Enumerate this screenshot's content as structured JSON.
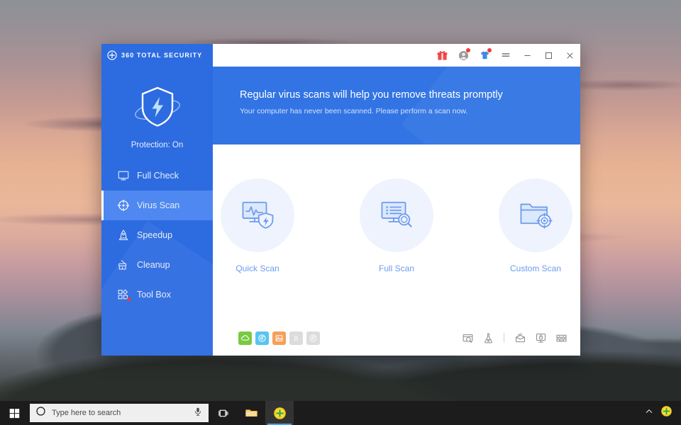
{
  "window": {
    "logo_text": "360 TOTAL SECURITY",
    "logo_icon": "circle-plus-icon",
    "title_icons": [
      {
        "name": "gift-icon",
        "badge": false
      },
      {
        "name": "user-account-icon",
        "badge": true
      },
      {
        "name": "skin-tshirt-icon",
        "badge": true
      },
      {
        "name": "hamburger-menu-icon",
        "badge": false
      }
    ],
    "controls": {
      "minimize": "minimize-icon",
      "maximize": "maximize-icon",
      "close": "close-icon"
    }
  },
  "sidebar": {
    "shield_icon": "shield-bolt-icon",
    "protection_status": "Protection: On",
    "items": [
      {
        "label": "Full Check",
        "icon": "monitor-icon",
        "active": false,
        "badge": false
      },
      {
        "label": "Virus Scan",
        "icon": "crosshair-target-icon",
        "active": true,
        "badge": false
      },
      {
        "label": "Speedup",
        "icon": "rocket-icon",
        "active": false,
        "badge": false
      },
      {
        "label": "Cleanup",
        "icon": "brush-icon",
        "active": false,
        "badge": false
      },
      {
        "label": "Tool Box",
        "icon": "toolbox-shapes-icon",
        "active": false,
        "badge": true
      }
    ]
  },
  "banner": {
    "title": "Regular virus scans will help you remove threats promptly",
    "subtitle": "Your computer has never been scanned. Please perform a scan now."
  },
  "scan_options": [
    {
      "label": "Quick Scan",
      "icon": "monitor-pulse-shield-icon"
    },
    {
      "label": "Full Scan",
      "icon": "monitor-list-magnifier-icon"
    },
    {
      "label": "Custom Scan",
      "icon": "folder-target-icon"
    }
  ],
  "engines": [
    {
      "name": "cloud-engine-icon",
      "color": "#7ac943",
      "enabled": true
    },
    {
      "name": "qvm-engine-icon",
      "color": "#59c4f0",
      "enabled": true
    },
    {
      "name": "avira-engine-icon",
      "color": "#f5a05a",
      "enabled": true
    },
    {
      "name": "bitdefender-engine-icon",
      "color": "#dcdcdc",
      "enabled": false
    },
    {
      "name": "system-repair-engine-icon",
      "color": "#dcdcdc",
      "enabled": false
    }
  ],
  "tools": [
    {
      "name": "browser-scan-icon"
    },
    {
      "name": "lab-flask-icon"
    },
    {
      "name": "separator"
    },
    {
      "name": "sandbox-icon"
    },
    {
      "name": "privacy-lock-icon"
    },
    {
      "name": "firewall-icon"
    }
  ],
  "taskbar": {
    "start_icon": "windows-start-icon",
    "search_icon": "cortana-circle-icon",
    "search_placeholder": "Type here to search",
    "mic_icon": "microphone-icon",
    "tasks": [
      {
        "name": "task-view-icon",
        "running": false
      },
      {
        "name": "file-explorer-icon",
        "running": false
      },
      {
        "name": "360-total-security-icon",
        "running": true
      }
    ],
    "tray": [
      {
        "name": "show-hidden-icons-chevron"
      },
      {
        "name": "360-tray-icon"
      }
    ]
  },
  "colors": {
    "sidebar_blue": "#2d6ce0",
    "banner_blue": "#3274e4",
    "active_blue": "#4e88f0",
    "accent_light": "#6d9bf0",
    "badge_red": "#ef3b3b"
  }
}
